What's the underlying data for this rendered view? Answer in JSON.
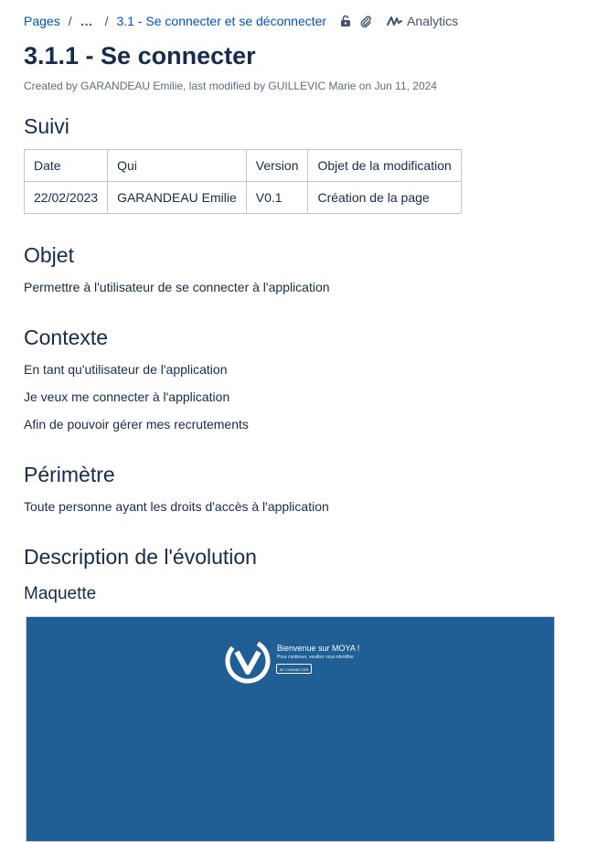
{
  "breadcrumb": {
    "root": "Pages",
    "separator": "/",
    "ellipsis": "…",
    "parent": "3.1 - Se connecter et se déconnecter",
    "analytics": "Analytics"
  },
  "title": "3.1.1 - Se connecter",
  "byline": "Created by GARANDEAU Emilie, last modified by GUILLEVIC Marie on Jun 11, 2024",
  "sections": {
    "suivi": "Suivi",
    "objet": "Objet",
    "contexte": "Contexte",
    "perimetre": "Périmètre",
    "description": "Description de l'évolution",
    "maquette": "Maquette"
  },
  "suivi_table": {
    "headers": [
      "Date",
      "Qui",
      "Version",
      "Objet de la modification"
    ],
    "rows": [
      [
        "22/02/2023",
        "GARANDEAU Emilie",
        "V0.1",
        "Création de la page"
      ]
    ]
  },
  "objet_text": "Permettre à l'utilisateur de se connecter à l'application",
  "contexte_lines": [
    "En tant qu'utilisateur de l'application",
    "Je veux me connecter à l'application",
    "Afin de pouvoir gérer mes recrutements"
  ],
  "perimetre_text": "Toute personne ayant les droits d'accès à l'application",
  "mockup": {
    "welcome": "Bienvenue sur MOYA !",
    "subtitle": "Pour continuer, veuillez vous identifier",
    "button": "SE CONNECTER",
    "background": "#1f5f95"
  },
  "colors": {
    "link": "#0052cc",
    "text": "#172b4d",
    "muted": "#5e6c84"
  }
}
